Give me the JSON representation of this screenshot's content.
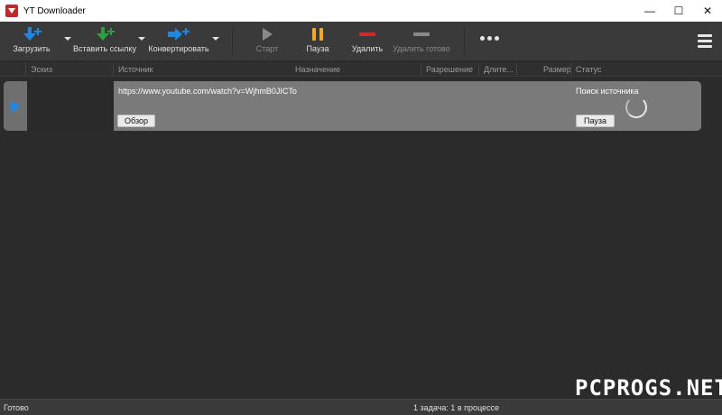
{
  "window": {
    "title": "YT Downloader",
    "controls": {
      "minimize": "—",
      "maximize": "☐",
      "close": "✕"
    }
  },
  "toolbar": {
    "download_label": "Загрузить",
    "paste_link_label": "Вставить ссылку",
    "convert_label": "Конвертировать",
    "start_label": "Старт",
    "pause_label": "Пауза",
    "delete_label": "Удалить",
    "delete_done_label": "Удалить готово",
    "icons": {
      "download": "download-plus-icon",
      "paste": "paste-link-plus-icon",
      "convert": "convert-plus-icon",
      "start": "play-icon",
      "pause": "pause-icon",
      "delete": "minus-icon",
      "delete_done": "minus-icon",
      "more": "more-dots-icon",
      "menu": "hamburger-icon"
    }
  },
  "columns": {
    "thumbnail": "Эскиз",
    "source": "Источник",
    "destination": "Назначение",
    "resolution": "Разрешение",
    "duration": "Длите...",
    "size": "Размер",
    "status": "Статус"
  },
  "tasks": [
    {
      "url": "https://www.youtube.com/watch?v=WjhmB0JICTo",
      "browse_label": "Обзор",
      "status": "Поиск источника",
      "pause_label": "Пауза"
    }
  ],
  "statusbar": {
    "left": "Готово",
    "right": "1 задача: 1 в процессе"
  },
  "watermark": "PCPROGS.NET",
  "colors": {
    "accent_blue": "#1e88e5",
    "green": "#2e9e3e",
    "orange": "#f5a623",
    "red": "#e02424",
    "disabled_gray": "#8a8a8a",
    "row_bg": "#7a7a7a"
  }
}
